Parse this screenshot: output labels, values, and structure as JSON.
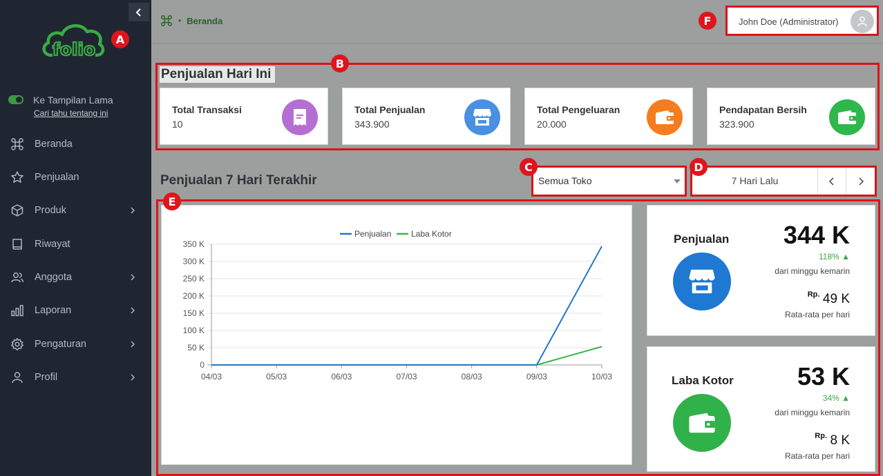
{
  "sidebar": {
    "brand": "folio",
    "toggle": {
      "label": "Ke Tampilan Lama",
      "link": "Cari tahu tentang ini"
    },
    "items": [
      {
        "label": "Beranda",
        "icon": "command-icon",
        "has_submenu": false
      },
      {
        "label": "Penjualan",
        "icon": "star-icon",
        "has_submenu": false
      },
      {
        "label": "Produk",
        "icon": "box-icon",
        "has_submenu": true
      },
      {
        "label": "Riwayat",
        "icon": "book-icon",
        "has_submenu": false
      },
      {
        "label": "Anggota",
        "icon": "users-icon",
        "has_submenu": true
      },
      {
        "label": "Laporan",
        "icon": "bar-chart-icon",
        "has_submenu": true
      },
      {
        "label": "Pengaturan",
        "icon": "gear-icon",
        "has_submenu": true
      },
      {
        "label": "Profil",
        "icon": "user-icon",
        "has_submenu": true
      }
    ]
  },
  "header": {
    "breadcrumb": "Beranda",
    "user": "John Doe (Administrator)"
  },
  "annotations": [
    "A",
    "B",
    "C",
    "D",
    "E",
    "F"
  ],
  "today": {
    "title": "Penjualan Hari Ini",
    "cards": [
      {
        "label": "Total Transaksi",
        "value": "10",
        "icon": "receipt-icon",
        "color": "#b56fd2"
      },
      {
        "label": "Total Penjualan",
        "value": "343.900",
        "icon": "store-icon",
        "color": "#4a90e2"
      },
      {
        "label": "Total Pengeluaran",
        "value": "20.000",
        "icon": "wallet-icon",
        "color": "#f57c1f"
      },
      {
        "label": "Pendapatan Bersih",
        "value": "323.900",
        "icon": "wallet-icon",
        "color": "#2eb84b"
      }
    ]
  },
  "weekly": {
    "title": "Penjualan 7 Hari Terakhir",
    "store_select": "Semua Toko",
    "range_label": "7 Hari Lalu"
  },
  "chart_data": {
    "type": "line",
    "title": "",
    "xlabel": "",
    "ylabel": "",
    "categories": [
      "04/03",
      "05/03",
      "06/03",
      "07/03",
      "08/03",
      "09/03",
      "10/03"
    ],
    "series": [
      {
        "name": "Penjualan",
        "color": "#1f77c9",
        "values": [
          0,
          0,
          0,
          0,
          0,
          0,
          343900
        ]
      },
      {
        "name": "Laba Kotor",
        "color": "#3ab54a",
        "values": [
          0,
          0,
          0,
          0,
          0,
          0,
          53000
        ]
      }
    ],
    "yticks": [
      "0",
      "50 K",
      "100 K",
      "150 K",
      "200 K",
      "250 K",
      "300 K",
      "350 K"
    ],
    "ylim": [
      0,
      350000
    ],
    "grid": true,
    "legend": "top"
  },
  "summary": [
    {
      "title": "Penjualan",
      "value": "344 K",
      "change": "118% ▲",
      "note": "dari minggu kemarin",
      "rp": "Rp.",
      "avg": "49 K",
      "avg_label": "Rata-rata per hari",
      "icon": "store-icon",
      "color": "#1f78d1"
    },
    {
      "title": "Laba Kotor",
      "value": "53 K",
      "change": "34% ▲",
      "note": "dari minggu kemarin",
      "rp": "Rp.",
      "avg": "8 K",
      "avg_label": "Rata-rata per hari",
      "icon": "wallet-icon",
      "color": "#31b14a"
    }
  ]
}
